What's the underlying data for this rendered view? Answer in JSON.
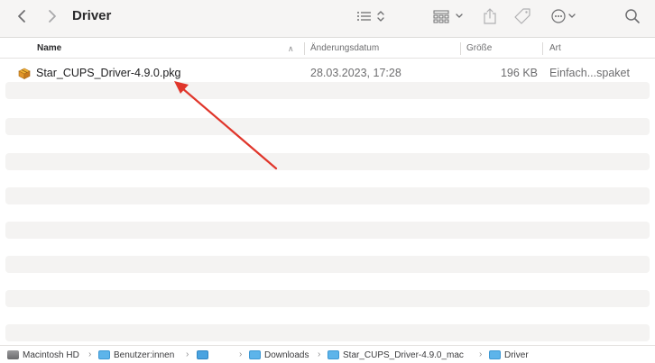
{
  "window": {
    "title": "Driver"
  },
  "toolbar": {
    "back_icon": "chevron-left-icon",
    "forward_icon": "chevron-right-icon",
    "view_list_icon": "list-view-icon",
    "group_icon": "grid-group-icon",
    "share_icon": "share-icon",
    "tag_icon": "tag-icon",
    "more_icon": "ellipsis-circle-icon",
    "search_icon": "search-icon"
  },
  "columns": {
    "name": "Name",
    "date": "Änderungsdatum",
    "size": "Größe",
    "kind": "Art"
  },
  "files": [
    {
      "name": "Star_CUPS_Driver-4.9.0.pkg",
      "date": "28.03.2023, 17:28",
      "size": "196 KB",
      "kind": "Einfach...spaket",
      "icon": "package-icon"
    }
  ],
  "pathbar": {
    "items": [
      {
        "label": "Macintosh HD",
        "icon": "hard-drive-icon"
      },
      {
        "label": "Benutzer:innen",
        "icon": "folder-icon"
      },
      {
        "label": "",
        "icon": "home-folder-icon"
      },
      {
        "label": "Downloads",
        "icon": "downloads-folder-icon"
      },
      {
        "label": "Star_CUPS_Driver-4.9.0_mac",
        "icon": "folder-icon"
      },
      {
        "label": "Driver",
        "icon": "folder-icon"
      }
    ]
  },
  "annotation": {
    "color": "#e0362b",
    "icon": "red-arrow"
  }
}
